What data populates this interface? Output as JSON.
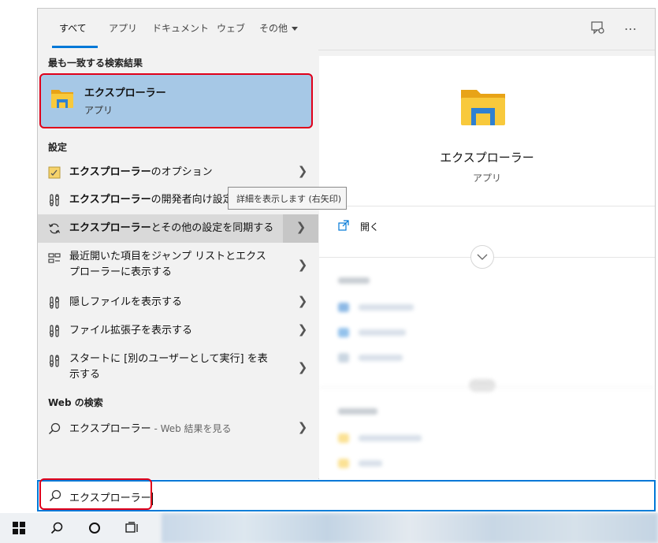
{
  "tabs": [
    {
      "label": "すべて",
      "active": true
    },
    {
      "label": "アプリ"
    },
    {
      "label": "ドキュメント"
    },
    {
      "label": "ウェブ"
    },
    {
      "label": "その他"
    }
  ],
  "top_icons": {
    "feedback": "feedback-icon",
    "more": "…"
  },
  "left": {
    "best_match_header": "最も一致する検索結果",
    "best_match": {
      "title": "エクスプローラー",
      "subtitle": "アプリ"
    },
    "settings_header": "設定",
    "settings_items": [
      {
        "bold": "エクスプローラー",
        "rest": "のオプション",
        "icon": "folder-options-icon"
      },
      {
        "bold": "エクスプローラー",
        "rest": "の開発者向け設定",
        "icon": "developer-settings-icon"
      },
      {
        "bold": "エクスプローラー",
        "rest": "とその他の設定を同期する",
        "icon": "sync-icon"
      },
      {
        "line1": "最近開いた項目をジャンプ リストとエクス",
        "line2": "プローラーに表示する",
        "icon": "jump-list-icon"
      },
      {
        "line1": "隠しファイルを表示する",
        "icon": "settings-slider-icon"
      },
      {
        "line1": "ファイル拡張子を表示する",
        "icon": "settings-slider-icon"
      },
      {
        "line1": "スタートに [別のユーザーとして実行] を表",
        "line2": "示する",
        "icon": "settings-slider-icon"
      }
    ],
    "web_header": "Web の検索",
    "web_item": {
      "query": "エクスプローラー",
      "suffix": " - Web 結果を見る"
    }
  },
  "tooltip": "詳細を表示します (右矢印)",
  "right": {
    "title": "エクスプローラー",
    "subtitle": "アプリ",
    "open_label": "開く"
  },
  "search": {
    "value": "エクスプローラー"
  },
  "colors": {
    "accent": "#0078d7",
    "highlight_border": "#e0001a",
    "best_match_bg": "#a6c8e6"
  }
}
